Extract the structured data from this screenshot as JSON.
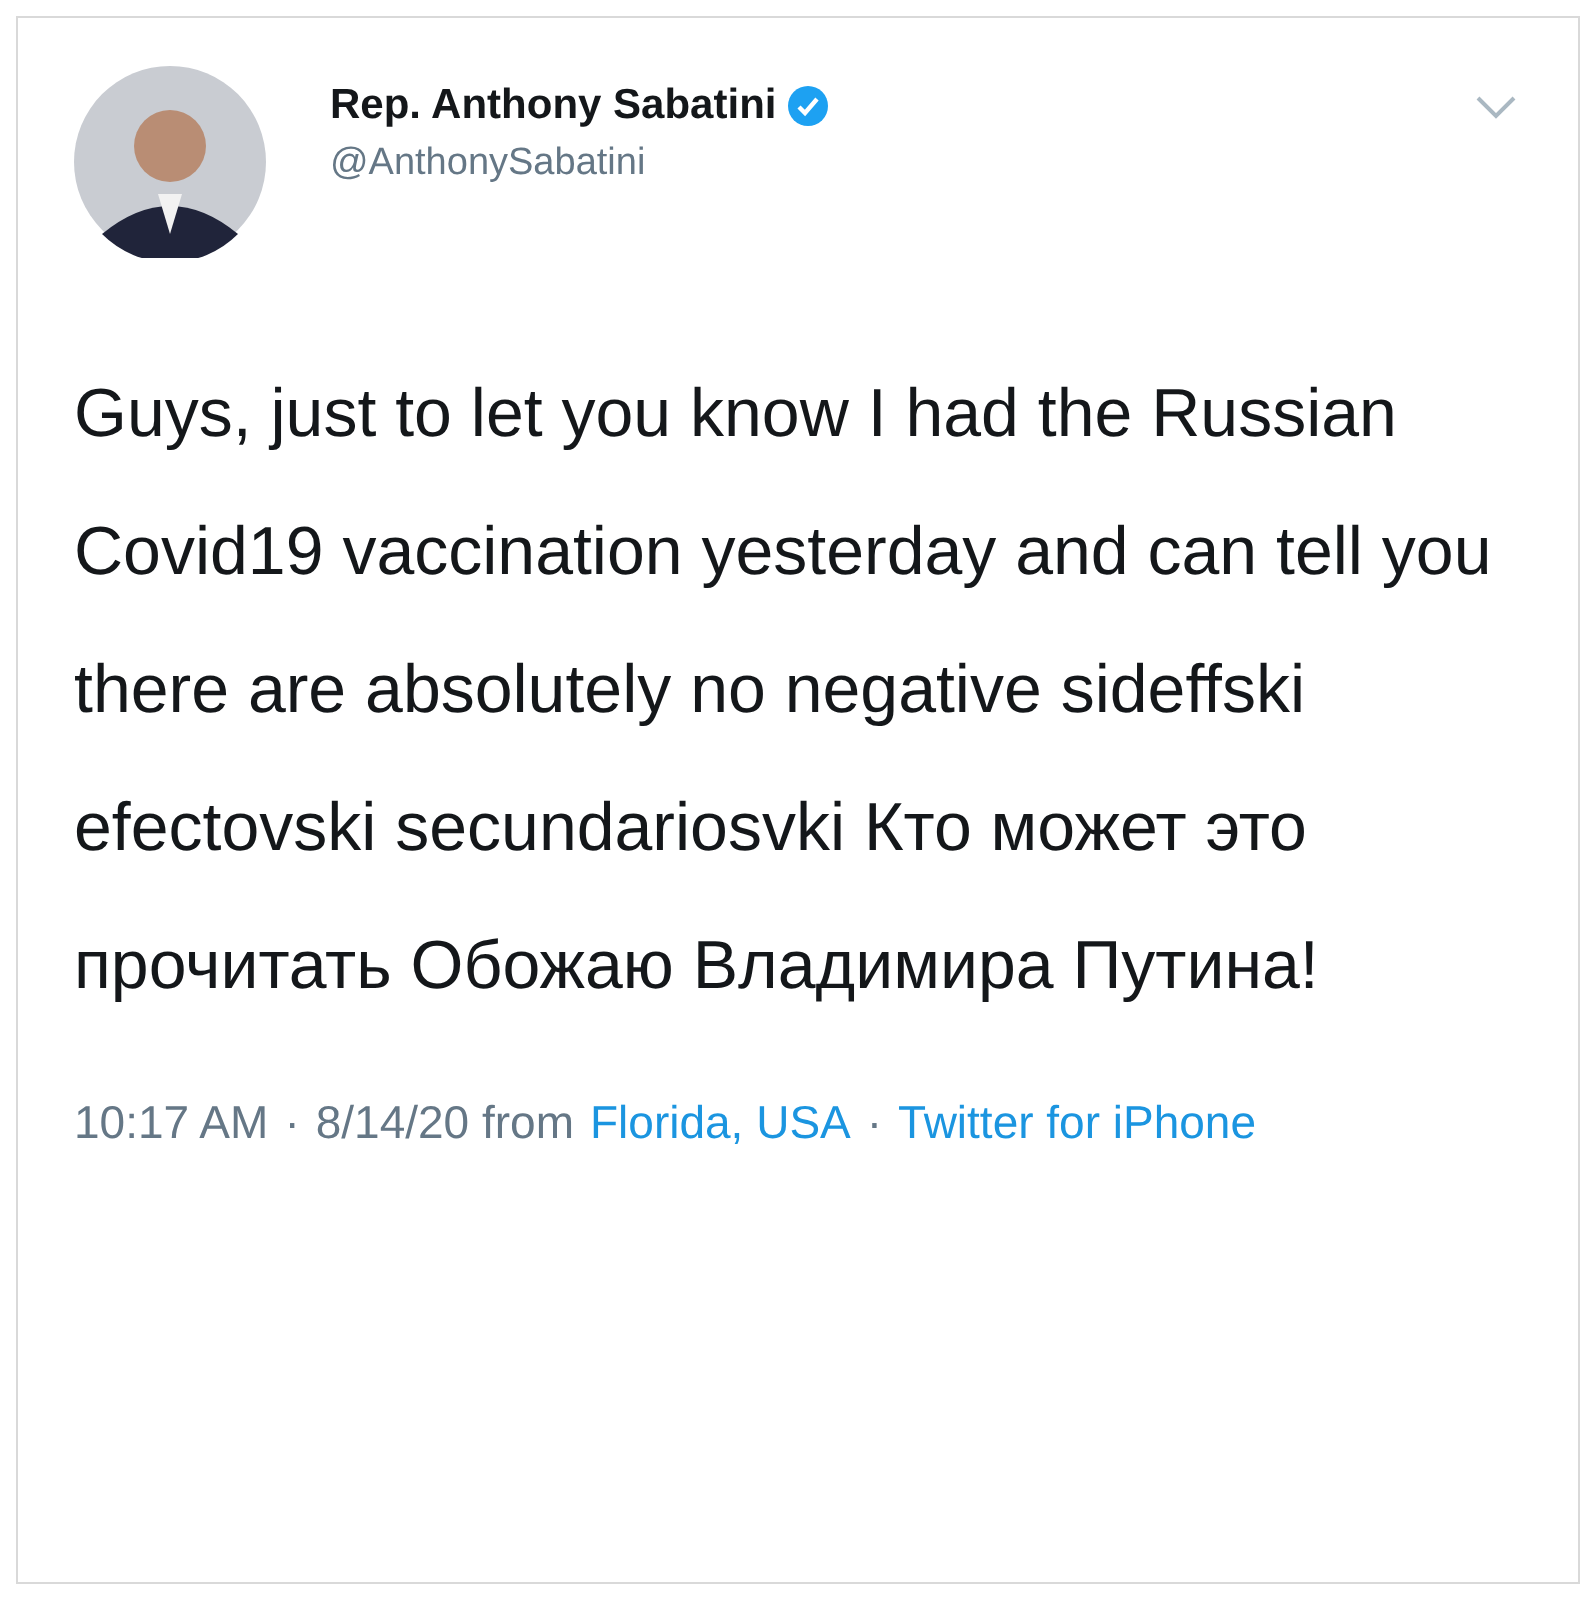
{
  "tweet": {
    "author": {
      "name": "Rep. Anthony Sabatini",
      "verified": true,
      "handle": "@AnthonySabatini"
    },
    "text": "Guys, just to let you know I had the Russian Covid19 vaccination yesterday and can tell you there are absolutely no negative sideffski efectovski secundariosvki Кто может это прочитать Обожаю Владимира Путина!",
    "footer": [
      {
        "kind": "text",
        "text": "10:17 AM"
      },
      {
        "kind": "separator",
        "text": "·"
      },
      {
        "kind": "text",
        "text": "8/14/20 from"
      },
      {
        "kind": "link",
        "text": "Florida, USA"
      },
      {
        "kind": "separator",
        "text": "·"
      },
      {
        "kind": "link",
        "text": "Twitter for iPhone"
      }
    ]
  }
}
